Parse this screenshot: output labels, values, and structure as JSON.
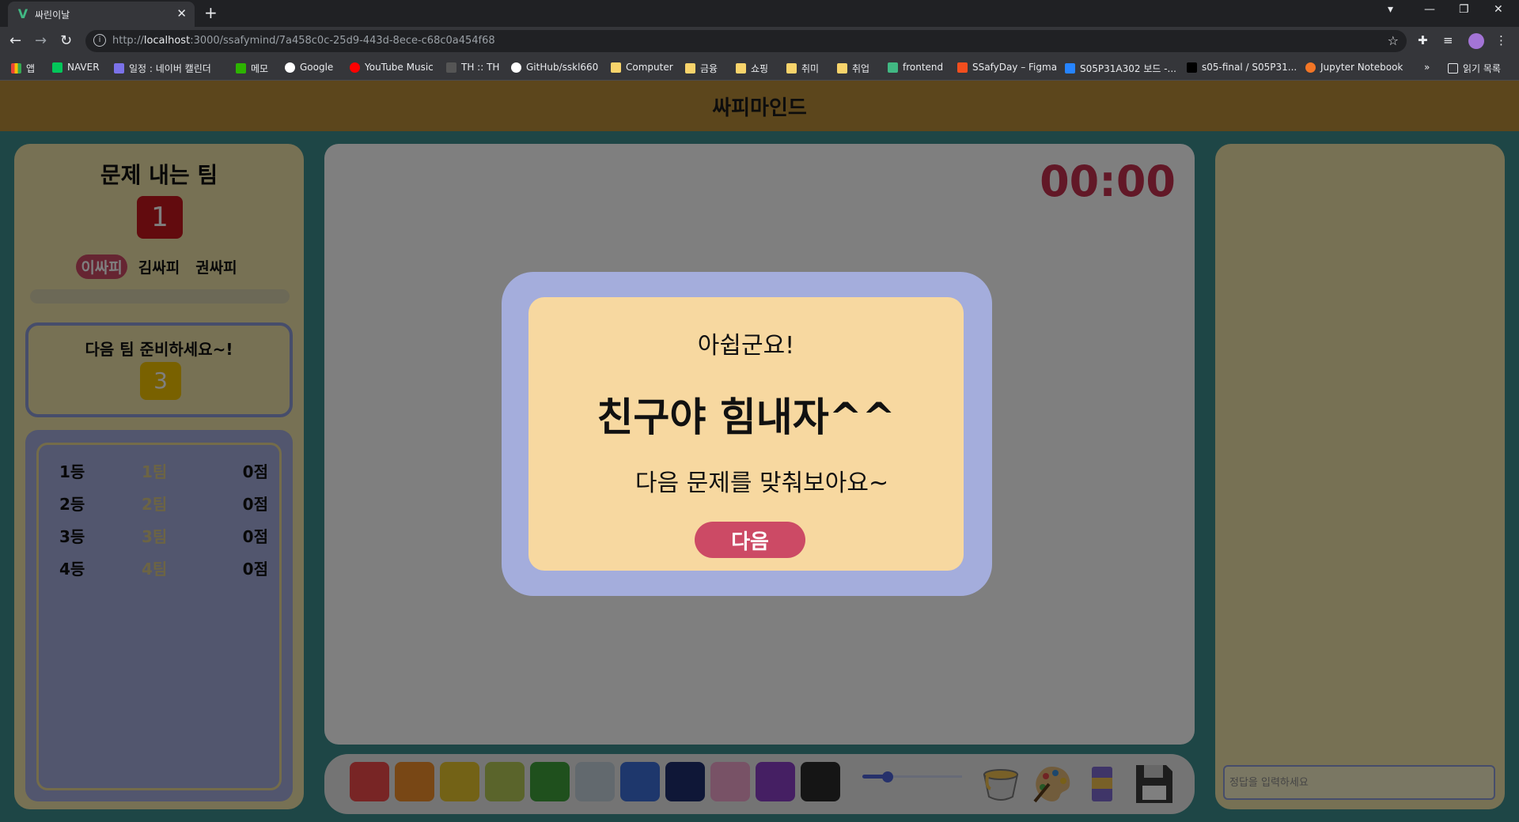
{
  "browser": {
    "tab_title": "싸린이날",
    "url_host": "localhost",
    "url_prefix": "http://",
    "url_rest": ":3000/ssafymind/7a458c0c-25d9-443d-8ece-c68c0a454f68",
    "bookmarks": [
      "앱",
      "NAVER",
      "일정 : 네이버 캘린더",
      "메모",
      "Google",
      "YouTube Music",
      "TH :: TH",
      "GitHub/sskl660",
      "Computer",
      "금융",
      "쇼핑",
      "취미",
      "취업",
      "frontend",
      "SSafyDay – Figma",
      "S05P31A302 보드 -...",
      "s05-final / S05P31...",
      "Jupyter Notebook"
    ],
    "bookmarks_more": "»",
    "reading_list": "읽기 목록"
  },
  "app": {
    "title": "싸피마인드"
  },
  "left": {
    "heading": "문제 내는 팀",
    "team_number": "1",
    "members": [
      {
        "name": "이싸피",
        "active": true
      },
      {
        "name": "김싸피",
        "active": false
      },
      {
        "name": "권싸피",
        "active": false
      }
    ],
    "progress": 0,
    "next_text": "다음 팀 준비하세요~!",
    "next_team": "3",
    "ranking": [
      {
        "rank": "1등",
        "team": "1팀",
        "score": "0점"
      },
      {
        "rank": "2등",
        "team": "2팀",
        "score": "0점"
      },
      {
        "rank": "3등",
        "team": "3팀",
        "score": "0점"
      },
      {
        "rank": "4등",
        "team": "4팀",
        "score": "0점"
      }
    ]
  },
  "canvas": {
    "timer": "00:00"
  },
  "toolbar": {
    "colors": [
      "#f04a4a",
      "#f08f2a",
      "#e6c52c",
      "#b5c957",
      "#3fa13a",
      "#c5d2dc",
      "#3c6fd8",
      "#1f2f6e",
      "#f1a4cc",
      "#8a3fc7",
      "#2a2a2a"
    ],
    "brush_size": 0.25,
    "tools": [
      "paint-bucket-icon",
      "palette-icon",
      "eraser-icon",
      "save-icon"
    ]
  },
  "right": {
    "answer_placeholder": "정답을 입력하세요"
  },
  "modal": {
    "line1": "아쉽군요!",
    "line2": "친구야 힘내자^^",
    "line3": "다음 문제를 맞춰보아요~",
    "button": "다음"
  }
}
